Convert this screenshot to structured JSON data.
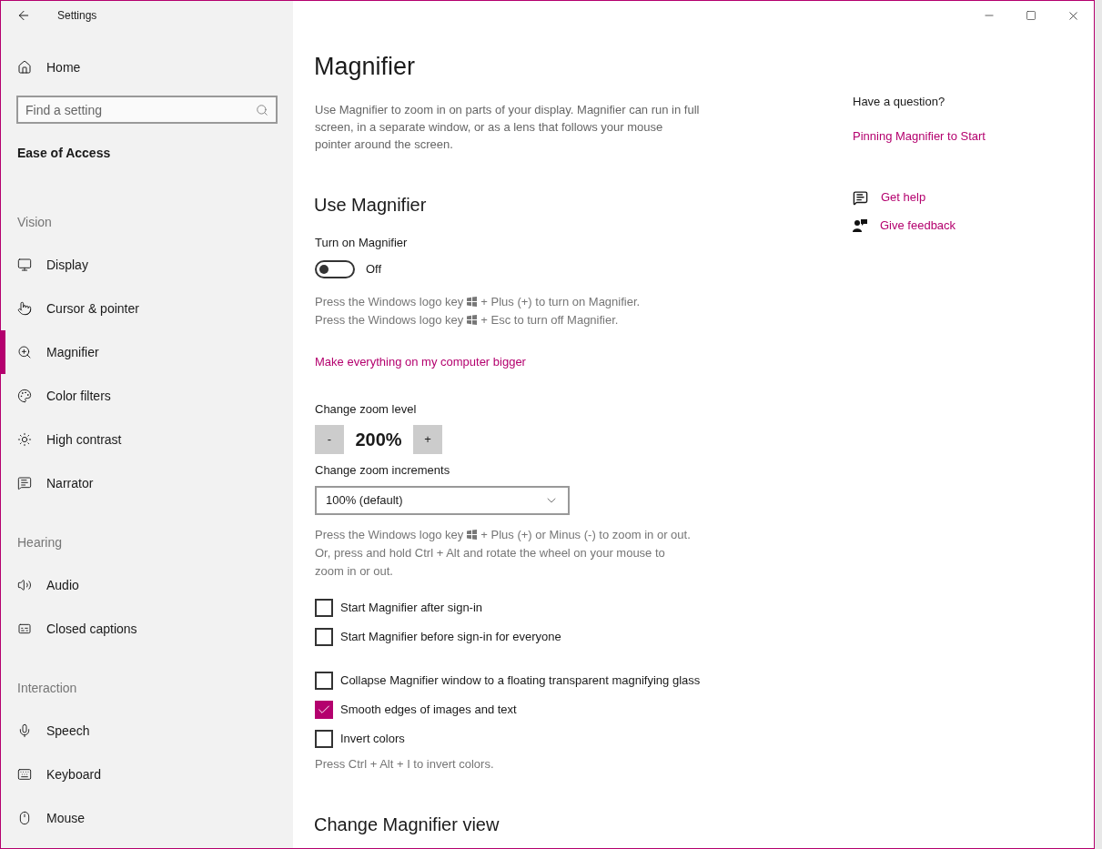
{
  "window": {
    "title": "Settings"
  },
  "sidebar": {
    "home": "Home",
    "search": {
      "placeholder": "Find a setting"
    },
    "section_title": "Ease of Access",
    "groups": [
      {
        "heading": "Vision",
        "items": [
          {
            "label": "Display",
            "selected": false
          },
          {
            "label": "Cursor & pointer",
            "selected": false
          },
          {
            "label": "Magnifier",
            "selected": true
          },
          {
            "label": "Color filters",
            "selected": false
          },
          {
            "label": "High contrast",
            "selected": false
          },
          {
            "label": "Narrator",
            "selected": false
          }
        ]
      },
      {
        "heading": "Hearing",
        "items": [
          {
            "label": "Audio",
            "selected": false
          },
          {
            "label": "Closed captions",
            "selected": false
          }
        ]
      },
      {
        "heading": "Interaction",
        "items": [
          {
            "label": "Speech",
            "selected": false
          },
          {
            "label": "Keyboard",
            "selected": false
          },
          {
            "label": "Mouse",
            "selected": false
          }
        ]
      }
    ]
  },
  "main": {
    "title": "Magnifier",
    "description": "Use Magnifier to zoom in on parts of your display. Magnifier can run in full screen, in a separate window, or as a lens that follows your mouse pointer around the screen.",
    "section_heading": "Use Magnifier",
    "toggle": {
      "label": "Turn on Magnifier",
      "on": false,
      "state_text": "Off"
    },
    "toggle_hints": [
      {
        "before": "Press the Windows logo key",
        "after": "+ Plus (+) to turn on Magnifier."
      },
      {
        "before": "Press the Windows logo key",
        "after": "+ Esc to turn off Magnifier."
      }
    ],
    "link": "Make everything on my computer bigger",
    "zoom": {
      "label": "Change zoom level",
      "decrease": "-",
      "value": "200%",
      "increase": "+"
    },
    "increments": {
      "label": "Change zoom increments",
      "value": "100% (default)"
    },
    "zoom_hint": {
      "before": "Press the Windows logo key",
      "after": "+ Plus (+) or Minus (-) to zoom in or out.",
      "more": "Or, press and hold Ctrl + Alt and rotate the wheel on your mouse to zoom in or out."
    },
    "checkbox_groups": [
      {
        "items": [
          {
            "label": "Start Magnifier after sign-in",
            "checked": false
          },
          {
            "label": "Start Magnifier before sign-in for everyone",
            "checked": false
          }
        ]
      },
      {
        "items": [
          {
            "label": "Collapse Magnifier window to a floating transparent magnifying glass",
            "checked": false
          },
          {
            "label": "Smooth edges of images and text",
            "checked": true
          },
          {
            "label": "Invert colors",
            "checked": false
          }
        ]
      }
    ],
    "invert_hint": "Press Ctrl + Alt + I to invert colors.",
    "next_heading": "Change Magnifier view"
  },
  "help": {
    "question": "Have a question?",
    "link": "Pinning Magnifier to Start",
    "actions": [
      "Get help",
      "Give feedback"
    ]
  }
}
